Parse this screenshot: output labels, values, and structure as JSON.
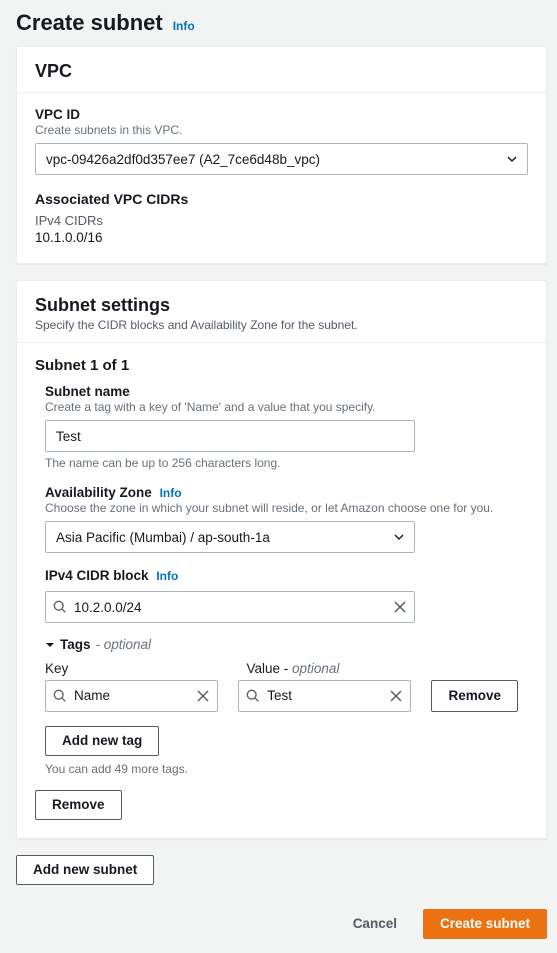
{
  "colors": {
    "primary": "#ec7211",
    "link": "#0073bb"
  },
  "page": {
    "title": "Create subnet",
    "info": "Info"
  },
  "vpc_panel": {
    "heading": "VPC",
    "vpc_id_label": "VPC ID",
    "vpc_id_help": "Create subnets in this VPC.",
    "vpc_selected": "vpc-09426a2df0d357ee7 (A2_7ce6d48b_vpc)",
    "assoc_heading": "Associated VPC CIDRs",
    "ipv4_label": "IPv4 CIDRs",
    "ipv4_value": "10.1.0.0/16"
  },
  "settings_panel": {
    "heading": "Subnet settings",
    "sub": "Specify the CIDR blocks and Availability Zone for the subnet."
  },
  "subnet": {
    "heading": "Subnet 1 of 1",
    "name_label": "Subnet name",
    "name_help": "Create a tag with a key of 'Name' and a value that you specify.",
    "name_value": "Test",
    "name_hint": "The name can be up to 256 characters long.",
    "az_label": "Availability Zone",
    "az_info": "Info",
    "az_help": "Choose the zone in which your subnet will reside, or let Amazon choose one for you.",
    "az_value": "Asia Pacific (Mumbai) / ap-south-1a",
    "cidr_label": "IPv4 CIDR block",
    "cidr_info": "Info",
    "cidr_value": "10.2.0.0/24",
    "tags_label": "Tags",
    "tags_optional": "- optional",
    "tags_cols": {
      "key": "Key",
      "value_prefix": "Value -",
      "value_optional": "optional"
    },
    "tag": {
      "key": "Name",
      "value": "Test"
    },
    "remove_tag": "Remove",
    "add_tag": "Add new tag",
    "tag_limit_text": "You can add 49 more tags.",
    "remove_subnet": "Remove"
  },
  "actions": {
    "add_subnet": "Add new subnet",
    "cancel": "Cancel",
    "create": "Create subnet"
  }
}
